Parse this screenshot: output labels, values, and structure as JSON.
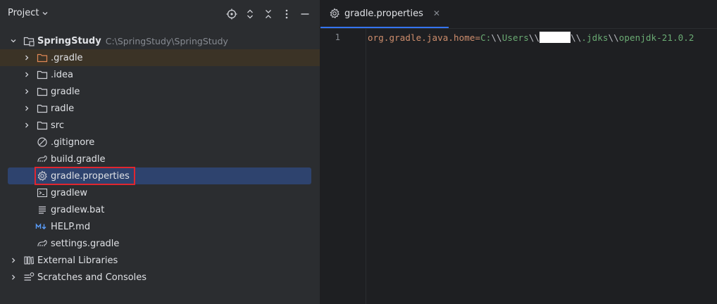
{
  "project_panel": {
    "title": "Project",
    "root": {
      "name": "SpringStudy",
      "path": "C:\\SpringStudy\\SpringStudy"
    },
    "items": [
      {
        "label": ".gradle",
        "kind": "folder-orange"
      },
      {
        "label": ".idea",
        "kind": "folder"
      },
      {
        "label": "gradle",
        "kind": "folder"
      },
      {
        "label": "radle",
        "kind": "folder"
      },
      {
        "label": "src",
        "kind": "folder"
      },
      {
        "label": ".gitignore",
        "kind": "ignore"
      },
      {
        "label": "build.gradle",
        "kind": "gradle"
      },
      {
        "label": "gradle.properties",
        "kind": "properties"
      },
      {
        "label": "gradlew",
        "kind": "shell"
      },
      {
        "label": "gradlew.bat",
        "kind": "bat"
      },
      {
        "label": "HELP.md",
        "kind": "markdown"
      },
      {
        "label": "settings.gradle",
        "kind": "gradle"
      }
    ],
    "external_libraries": "External Libraries",
    "scratches": "Scratches and Consoles"
  },
  "editor": {
    "tab_label": "gradle.properties",
    "line_number": "1",
    "code": {
      "key": "org.gradle.java.home",
      "eq": "=",
      "drive": "C:",
      "esc1": "\\\\",
      "users": "Users",
      "esc2": "\\\\",
      "esc3": "\\\\",
      "jdks": ".jdks",
      "esc4": "\\\\",
      "jdk": "openjdk-21.0.2"
    }
  }
}
